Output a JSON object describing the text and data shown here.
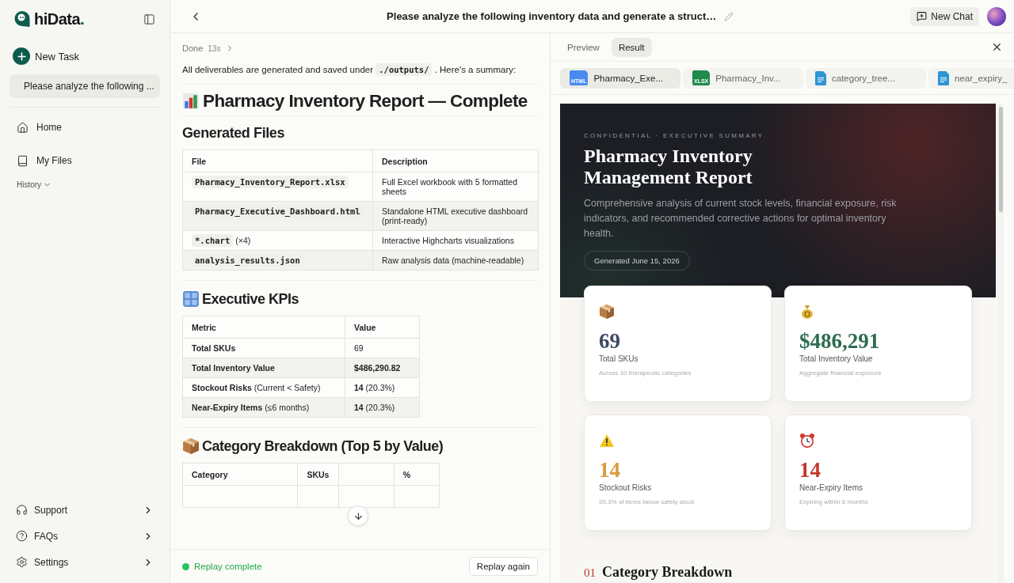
{
  "sidebar": {
    "logo": {
      "name": "hiData",
      "mark": "."
    },
    "new_task": "New Task",
    "tasks": [
      {
        "label": "Please analyze the following ...",
        "selected": true
      }
    ],
    "nav": [
      {
        "label": "Home",
        "kind": "home"
      },
      {
        "label": "My Files",
        "kind": "files"
      }
    ],
    "history": "History",
    "footer": [
      {
        "label": "Support",
        "kind": "support"
      },
      {
        "label": "FAQs",
        "kind": "faq"
      },
      {
        "label": "Settings",
        "kind": "settings"
      }
    ]
  },
  "topbar": {
    "title": "Please analyze the following inventory data and generate a struct…",
    "new_chat": "New Chat"
  },
  "chat": {
    "status": "Done",
    "duration": "13s",
    "intro": {
      "before": "All deliverables are generated and saved under",
      "code": "./outputs/",
      "after": ". Here's a summary:"
    },
    "title": {
      "kind": "chart",
      "text": "Pharmacy Inventory Report — Complete"
    },
    "files_heading": "Generated Files",
    "files_table": {
      "columns": [
        "File",
        "Description"
      ],
      "rows": [
        {
          "code": "Pharmacy_Inventory_Report.xlsx",
          "description": "Full Excel workbook with 5 formatted sheets"
        },
        {
          "code": "Pharmacy_Executive_Dashboard.html",
          "description": "Standalone HTML executive dashboard (print-ready)"
        },
        {
          "code": "*.chart",
          "note": "(×4)",
          "description": "Interactive Highcharts visualizations"
        },
        {
          "code": "analysis_results.json",
          "description": "Raw analysis data (machine-readable)"
        }
      ]
    },
    "kpi_heading": {
      "kind": "numbers",
      "text": "Executive KPIs"
    },
    "kpi_table": {
      "columns": [
        "Metric",
        "Value"
      ],
      "rows": [
        {
          "metric": "**Total SKUs**",
          "value": "69",
          "emphasis": false
        },
        {
          "metric": "**Total Inventory Value**",
          "value": "$486,290.82",
          "emphasis": true
        },
        {
          "metric": "**Stockout Risks** (Current < Safety)",
          "value": "**14** (20.3%)",
          "emphasis": false
        },
        {
          "metric": "**Near-Expiry Items** (≤6 months)",
          "value": "**14** (20.3%)",
          "emphasis": false
        }
      ]
    },
    "category_heading": {
      "kind": "box",
      "text": "Category Breakdown (Top 5 by Value)"
    },
    "category_table": {
      "columns": [
        {
          "label": "Category"
        },
        {
          "label": "SKUs"
        },
        {},
        {
          "label": "%"
        }
      ]
    },
    "replay_status": "Replay complete",
    "replay_button": "Replay again"
  },
  "panel": {
    "tabs": [
      {
        "label": "Preview",
        "selected": false
      },
      {
        "label": "Result",
        "selected": true
      }
    ],
    "files": [
      {
        "label": "Pharmacy_Exe...",
        "kind": "web",
        "badge": "HTML",
        "selected": true
      },
      {
        "label": "Pharmacy_Inv...",
        "kind": "sheet",
        "badge": "XLSX",
        "selected": false
      },
      {
        "label": "category_tree...",
        "kind": "doc",
        "selected": false
      },
      {
        "label": "near_expiry_",
        "kind": "doc",
        "selected": false
      }
    ],
    "report": {
      "eyebrow": "CONFIDENTIAL · EXECUTIVE SUMMARY",
      "title": "Pharmacy Inventory Management Report",
      "summary": "Comprehensive analysis of current stock levels, financial exposure, risk indicators, and recommended corrective actions for optimal inventory health.",
      "generated": "Generated June 15, 2026",
      "cards": [
        {
          "kind": "box",
          "value": "69",
          "label": "Total SKUs",
          "note": "Across 10 therapeutic categories",
          "color": "#3e4a62"
        },
        {
          "kind": "money",
          "value": "$486,291",
          "label": "Total Inventory Value",
          "note": "Aggregate financial exposure",
          "color": "#2e6b4f"
        },
        {
          "kind": "warning",
          "value": "14",
          "label": "Stockout Risks",
          "note": "20.3% of items below safety stock",
          "color": "#d99a3a"
        },
        {
          "kind": "clock",
          "value": "14",
          "label": "Near-Expiry Items",
          "note": "Expiring within 6 months",
          "color": "#c2392b"
        }
      ],
      "section": {
        "number": "01",
        "title": "Category Breakdown"
      }
    }
  }
}
